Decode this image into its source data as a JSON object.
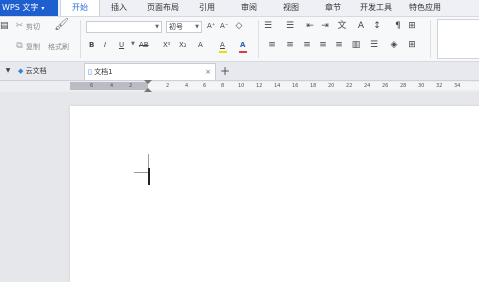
{
  "app": {
    "title": "WPS 文字",
    "title_dropdown": "▾"
  },
  "menu": {
    "tabs": [
      {
        "id": "home",
        "label": "开始",
        "active": true
      },
      {
        "id": "insert",
        "label": "插入"
      },
      {
        "id": "page_layout",
        "label": "页面布局"
      },
      {
        "id": "references",
        "label": "引用"
      },
      {
        "id": "review",
        "label": "审阅"
      },
      {
        "id": "view",
        "label": "视图"
      },
      {
        "id": "section",
        "label": "章节"
      },
      {
        "id": "developer",
        "label": "开发工具"
      },
      {
        "id": "special",
        "label": "特色应用"
      }
    ]
  },
  "ribbon": {
    "cut_label": "剪切",
    "copy_label": "复制",
    "format_painter_label": "格式刷",
    "font_name_value": "",
    "font_size_value": "初号",
    "font_buttons": [
      "B",
      "I",
      "U",
      "AB",
      "X²",
      "X₂",
      "A",
      "A",
      "A"
    ],
    "grow_font": "A⁺",
    "shrink_font": "A⁻"
  },
  "tabs": {
    "cloud_docs": "云文档",
    "active_doc": "文档1",
    "close": "×",
    "new_tab": "+"
  },
  "ruler": {
    "ticks": [
      "6",
      "4",
      "2",
      "2",
      "4",
      "6",
      "8",
      "10",
      "12",
      "14",
      "16",
      "18",
      "20",
      "22",
      "24",
      "26",
      "28",
      "30",
      "32",
      "34"
    ]
  },
  "colors": {
    "title_blue": "#1e5fd0",
    "active_tab_text": "#2b6fd8",
    "font_color_red": "#e03c31",
    "highlight_yellow": "#f5d800"
  }
}
